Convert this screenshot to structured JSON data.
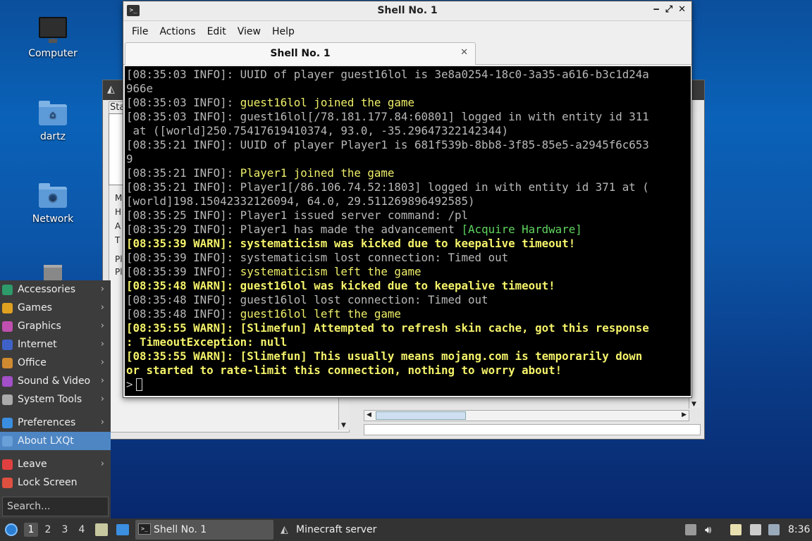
{
  "desktop": {
    "icons": [
      {
        "label": "Computer"
      },
      {
        "label": "dartz"
      },
      {
        "label": "Network"
      }
    ]
  },
  "back_window": {
    "letters": [
      "M",
      "H",
      "A",
      "T",
      "Pl",
      "Pl"
    ],
    "tab_fragment": "Sta"
  },
  "shell": {
    "title": "Shell No. 1",
    "menu": [
      "File",
      "Actions",
      "Edit",
      "View",
      "Help"
    ],
    "tab_label": "Shell No. 1",
    "title_buttons": [
      "‒",
      "⤢",
      "✕"
    ],
    "lines": [
      [
        {
          "t": "[08:35:03 INFO]: UUID of player guest16lol is 3e8a0254-18c0-3a35-a616-b3c1d24a",
          "c": "n"
        }
      ],
      [
        {
          "t": "966e",
          "c": "n"
        }
      ],
      [
        {
          "t": "[08:35:03 INFO]: ",
          "c": "n"
        },
        {
          "t": "guest16lol joined the game",
          "c": "y"
        }
      ],
      [
        {
          "t": "[08:35:03 INFO]: guest16lol[/78.181.177.84:60801] logged in with entity id 311",
          "c": "n"
        }
      ],
      [
        {
          "t": " at ([world]250.75417619410374, 93.0, -35.29647322142344)",
          "c": "n"
        }
      ],
      [
        {
          "t": "[08:35:21 INFO]: UUID of player Player1 is 681f539b-8bb8-3f85-85e5-a2945f6c653",
          "c": "n"
        }
      ],
      [
        {
          "t": "9",
          "c": "n"
        }
      ],
      [
        {
          "t": "[08:35:21 INFO]: ",
          "c": "n"
        },
        {
          "t": "Player1 joined the game",
          "c": "y"
        }
      ],
      [
        {
          "t": "[08:35:21 INFO]: Player1[/86.106.74.52:1803] logged in with entity id 371 at (",
          "c": "n"
        }
      ],
      [
        {
          "t": "[world]198.15042332126094, 64.0, 29.511269896492585)",
          "c": "n"
        }
      ],
      [
        {
          "t": "[08:35:25 INFO]: Player1 issued server command: /pl",
          "c": "n"
        }
      ],
      [
        {
          "t": "[08:35:29 INFO]: Player1 has made the advancement ",
          "c": "n"
        },
        {
          "t": "[Acquire Hardware]",
          "c": "g"
        }
      ],
      [
        {
          "t": "[08:35:39 WARN]: systematicism was kicked due to keepalive timeout!",
          "c": "w"
        }
      ],
      [
        {
          "t": "[08:35:39 INFO]: systematicism lost connection: Timed out",
          "c": "n"
        }
      ],
      [
        {
          "t": "[08:35:39 INFO]: ",
          "c": "n"
        },
        {
          "t": "systematicism left the game",
          "c": "y"
        }
      ],
      [
        {
          "t": "[08:35:48 WARN]: guest16lol was kicked due to keepalive timeout!",
          "c": "w"
        }
      ],
      [
        {
          "t": "[08:35:48 INFO]: guest16lol lost connection: Timed out",
          "c": "n"
        }
      ],
      [
        {
          "t": "[08:35:48 INFO]: ",
          "c": "n"
        },
        {
          "t": "guest16lol left the game",
          "c": "y"
        }
      ],
      [
        {
          "t": "[08:35:55 WARN]: [Slimefun] Attempted to refresh skin cache, got this response",
          "c": "w"
        }
      ],
      [
        {
          "t": ": TimeoutException: null",
          "c": "w"
        }
      ],
      [
        {
          "t": "[08:35:55 WARN]: [Slimefun] This usually means mojang.com is temporarily down",
          "c": "w"
        }
      ],
      [
        {
          "t": "or started to rate-limit this connection, nothing to worry about!",
          "c": "w"
        }
      ]
    ],
    "prompt": ">"
  },
  "start_menu": {
    "items": [
      {
        "label": "Accessories",
        "icon": "accessories-icon",
        "color": "#2d9b6a",
        "submenu": true
      },
      {
        "label": "Games",
        "icon": "games-icon",
        "color": "#e0a020",
        "submenu": true
      },
      {
        "label": "Graphics",
        "icon": "graphics-icon",
        "color": "#c04fb0",
        "submenu": true
      },
      {
        "label": "Internet",
        "icon": "internet-icon",
        "color": "#3f62c8",
        "submenu": true
      },
      {
        "label": "Office",
        "icon": "office-icon",
        "color": "#d08a30",
        "submenu": true
      },
      {
        "label": "Sound & Video",
        "icon": "sound-video-icon",
        "color": "#a24fc8",
        "submenu": true
      },
      {
        "label": "System Tools",
        "icon": "system-tools-icon",
        "color": "#aaaaaa",
        "submenu": true
      }
    ],
    "items2": [
      {
        "label": "Preferences",
        "icon": "preferences-icon",
        "color": "#3a8ee0",
        "submenu": true
      },
      {
        "label": "About LXQt",
        "icon": "about-icon",
        "color": "#6aa0d8",
        "submenu": false
      }
    ],
    "items3": [
      {
        "label": "Leave",
        "icon": "leave-icon",
        "color": "#e04040",
        "submenu": true
      },
      {
        "label": "Lock Screen",
        "icon": "lock-icon",
        "color": "#e05040",
        "submenu": false
      }
    ],
    "search_placeholder": "Search..."
  },
  "taskbar": {
    "desktops": [
      "1",
      "2",
      "3",
      "4"
    ],
    "tasks": [
      {
        "label": "Shell No. 1"
      },
      {
        "label": "Minecraft server"
      }
    ],
    "clock": "8:36"
  }
}
